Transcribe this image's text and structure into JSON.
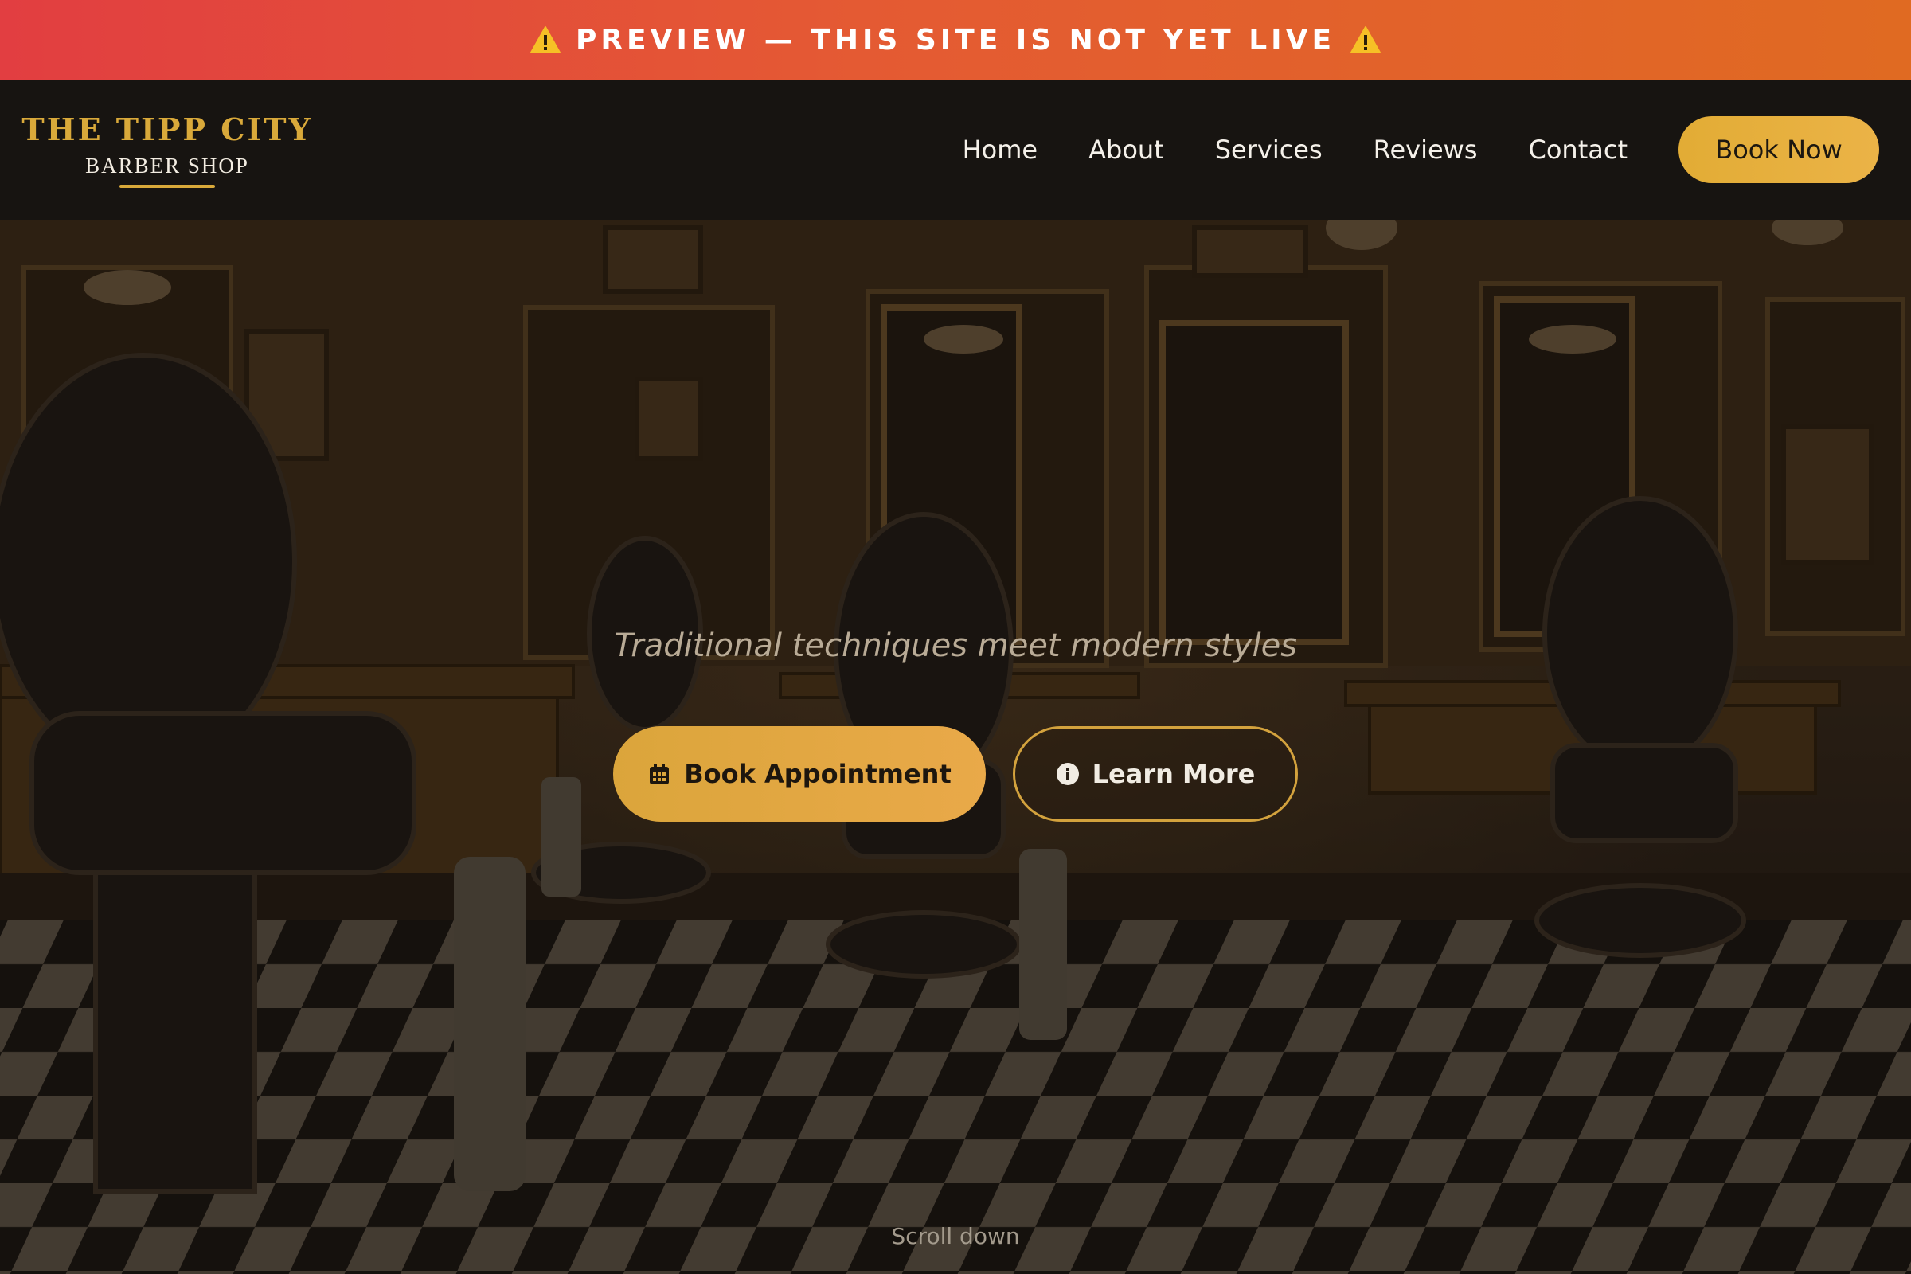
{
  "banner": {
    "text": "PREVIEW — THIS SITE IS NOT YET LIVE",
    "icon": "warning-icon",
    "colors": [
      "#e23e41",
      "#e06a22"
    ]
  },
  "brand": {
    "title": "THE TIPP CITY",
    "subtitle": "BARBER SHOP",
    "accent": "#d9a93a"
  },
  "nav": {
    "items": [
      {
        "label": "Home"
      },
      {
        "label": "About"
      },
      {
        "label": "Services"
      },
      {
        "label": "Reviews"
      },
      {
        "label": "Contact"
      }
    ],
    "cta": "Book Now"
  },
  "hero": {
    "tagline": "Traditional techniques meet modern styles",
    "primary_button": {
      "label": "Book Appointment",
      "icon": "calendar-icon"
    },
    "secondary_button": {
      "label": "Learn More",
      "icon": "info-icon"
    },
    "scroll_label": "Scroll down",
    "background": "barbershop-interior-image"
  }
}
